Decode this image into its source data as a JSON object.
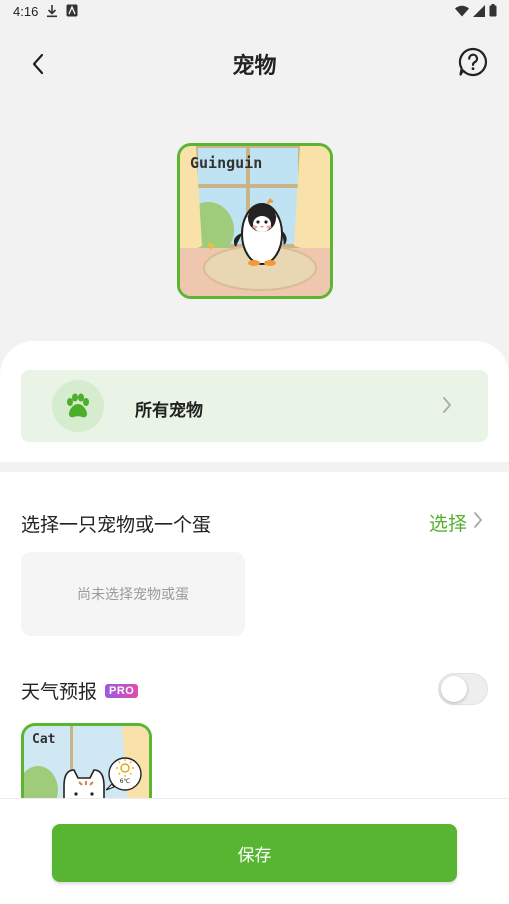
{
  "status_bar": {
    "time": "4:16",
    "left_icons": [
      "download-icon",
      "font-icon"
    ],
    "right_icons": [
      "wifi-icon",
      "signal-icon",
      "battery-icon"
    ]
  },
  "header": {
    "title": "宠物",
    "back_icon": "chevron-left-icon",
    "help_icon": "help-circle-icon"
  },
  "hero": {
    "label": "Guinguin"
  },
  "all_pets": {
    "label": "所有宠物"
  },
  "pet_select": {
    "label": "选择一只宠物或一个蛋",
    "action_label": "选择",
    "placeholder": "尚未选择宠物或蛋"
  },
  "weather": {
    "label": "天气预报",
    "badge": "PRO",
    "enabled": false,
    "preview_label": "Cat",
    "preview_temp": "6℃"
  },
  "footer": {
    "save_label": "保存"
  },
  "colors": {
    "accent_green": "#57b532",
    "card_green_bg": "#e9f4e6",
    "background": "#f2f2f2"
  }
}
